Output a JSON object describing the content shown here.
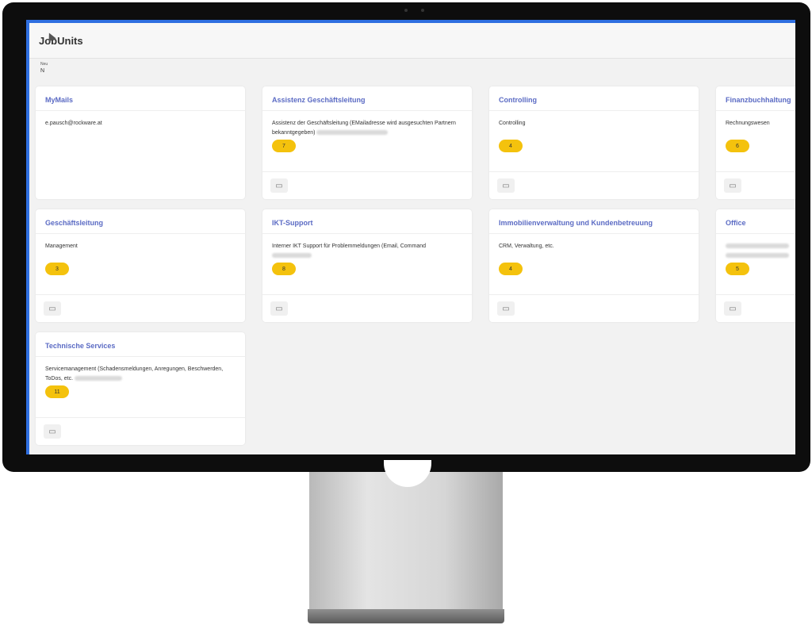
{
  "app": {
    "title": "JobUnits"
  },
  "filter": {
    "label": "Neu",
    "value": "N"
  },
  "cards": [
    {
      "title": "MyMails",
      "desc": "e.pausch@rockware.at",
      "count": "",
      "blurred": false
    },
    {
      "title": "Assistenz Geschäftsleitung",
      "desc": "Assistenz der Geschäftsleitung (EMailadresse wird ausgesuchten Partnern bekanntgegeben)",
      "count": "7",
      "blurred": true
    },
    {
      "title": "Controlling",
      "desc": "Controlling",
      "count": "4",
      "blurred": false
    },
    {
      "title": "Finanzbuchhaltung",
      "desc": "Rechnungswesen",
      "count": "6",
      "blurred": false
    },
    {
      "title": "Geschäftsleitung",
      "desc": "Management",
      "count": "3",
      "blurred": false
    },
    {
      "title": "IKT-Support",
      "desc": "Interner IKT Support für Problemmeldungen (Email, Command",
      "count": "8",
      "blurred": true
    },
    {
      "title": "Immobilienverwaltung und Kundenbetreuung",
      "desc": "CRM, Verwaltung, etc.",
      "count": "4",
      "blurred": false
    },
    {
      "title": "Office",
      "desc": "",
      "count": "5",
      "blurred": true
    },
    {
      "title": "Technische Services",
      "desc": "Servicemanagement (Schadensmeldungen, Anregungen, Beschwerden, ToDos, etc.",
      "count": "11",
      "blurred": true
    }
  ]
}
